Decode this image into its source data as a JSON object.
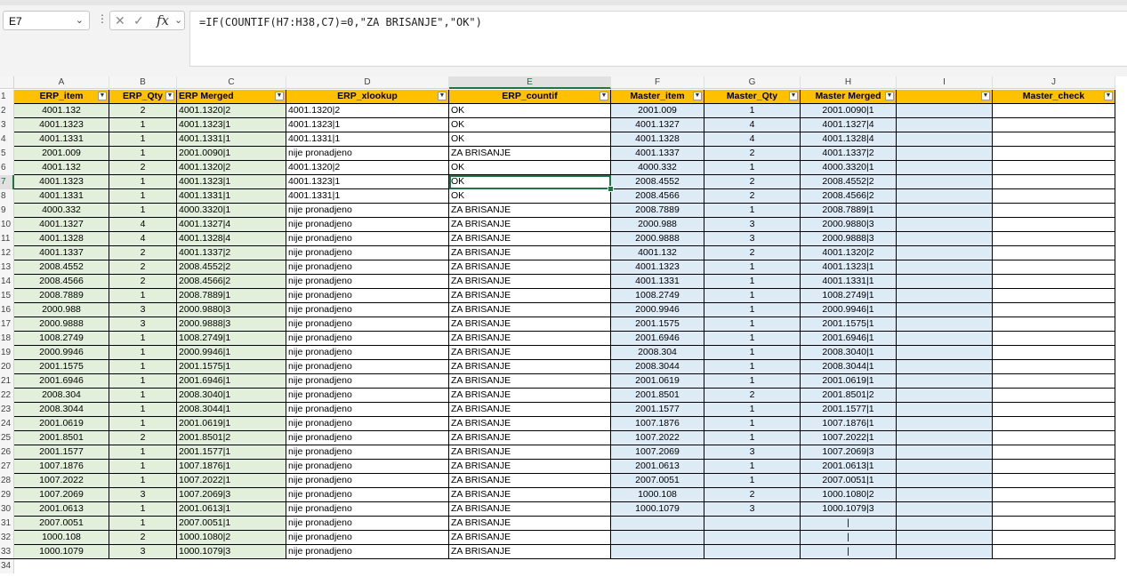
{
  "name_box": {
    "value": "E7",
    "dropdown_icon": "chevron-down-icon"
  },
  "formula_bar": {
    "separator": "⋮",
    "cancel_icon": "close-icon",
    "enter_icon": "check-icon",
    "fx_label": "fx",
    "formula": "=IF(COUNTIF(H7:H38,C7)=0,\"ZA BRISANJE\",\"OK\")"
  },
  "columns": [
    "A",
    "B",
    "C",
    "D",
    "E",
    "F",
    "G",
    "H",
    "I",
    "J"
  ],
  "selected_column": "E",
  "selected_row": 7,
  "headers": [
    "ERP_item",
    "ERP_Qty",
    "ERP Merged",
    "ERP_xlookup",
    "ERP_countif",
    "Master_item",
    "Master_Qty",
    "Master Merged",
    "",
    "Master_check"
  ],
  "rows": [
    [
      "4001.132",
      "2",
      "4001.1320|2",
      "4001.1320|2",
      "OK",
      "2001.009",
      "1",
      "2001.0090|1",
      "",
      ""
    ],
    [
      "4001.1323",
      "1",
      "4001.1323|1",
      "4001.1323|1",
      "OK",
      "4001.1327",
      "4",
      "4001.1327|4",
      "",
      ""
    ],
    [
      "4001.1331",
      "1",
      "4001.1331|1",
      "4001.1331|1",
      "OK",
      "4001.1328",
      "4",
      "4001.1328|4",
      "",
      ""
    ],
    [
      "2001.009",
      "1",
      "2001.0090|1",
      "nije pronadjeno",
      "ZA BRISANJE",
      "4001.1337",
      "2",
      "4001.1337|2",
      "",
      ""
    ],
    [
      "4001.132",
      "2",
      "4001.1320|2",
      "4001.1320|2",
      "OK",
      "4000.332",
      "1",
      "4000.3320|1",
      "",
      ""
    ],
    [
      "4001.1323",
      "1",
      "4001.1323|1",
      "4001.1323|1",
      "OK",
      "2008.4552",
      "2",
      "2008.4552|2",
      "",
      ""
    ],
    [
      "4001.1331",
      "1",
      "4001.1331|1",
      "4001.1331|1",
      "OK",
      "2008.4566",
      "2",
      "2008.4566|2",
      "",
      ""
    ],
    [
      "4000.332",
      "1",
      "4000.3320|1",
      "nije pronadjeno",
      "ZA BRISANJE",
      "2008.7889",
      "1",
      "2008.7889|1",
      "",
      ""
    ],
    [
      "4001.1327",
      "4",
      "4001.1327|4",
      "nije pronadjeno",
      "ZA BRISANJE",
      "2000.988",
      "3",
      "2000.9880|3",
      "",
      ""
    ],
    [
      "4001.1328",
      "4",
      "4001.1328|4",
      "nije pronadjeno",
      "ZA BRISANJE",
      "2000.9888",
      "3",
      "2000.9888|3",
      "",
      ""
    ],
    [
      "4001.1337",
      "2",
      "4001.1337|2",
      "nije pronadjeno",
      "ZA BRISANJE",
      "4001.132",
      "2",
      "4001.1320|2",
      "",
      ""
    ],
    [
      "2008.4552",
      "2",
      "2008.4552|2",
      "nije pronadjeno",
      "ZA BRISANJE",
      "4001.1323",
      "1",
      "4001.1323|1",
      "",
      ""
    ],
    [
      "2008.4566",
      "2",
      "2008.4566|2",
      "nije pronadjeno",
      "ZA BRISANJE",
      "4001.1331",
      "1",
      "4001.1331|1",
      "",
      ""
    ],
    [
      "2008.7889",
      "1",
      "2008.7889|1",
      "nije pronadjeno",
      "ZA BRISANJE",
      "1008.2749",
      "1",
      "1008.2749|1",
      "",
      ""
    ],
    [
      "2000.988",
      "3",
      "2000.9880|3",
      "nije pronadjeno",
      "ZA BRISANJE",
      "2000.9946",
      "1",
      "2000.9946|1",
      "",
      ""
    ],
    [
      "2000.9888",
      "3",
      "2000.9888|3",
      "nije pronadjeno",
      "ZA BRISANJE",
      "2001.1575",
      "1",
      "2001.1575|1",
      "",
      ""
    ],
    [
      "1008.2749",
      "1",
      "1008.2749|1",
      "nije pronadjeno",
      "ZA BRISANJE",
      "2001.6946",
      "1",
      "2001.6946|1",
      "",
      ""
    ],
    [
      "2000.9946",
      "1",
      "2000.9946|1",
      "nije pronadjeno",
      "ZA BRISANJE",
      "2008.304",
      "1",
      "2008.3040|1",
      "",
      ""
    ],
    [
      "2001.1575",
      "1",
      "2001.1575|1",
      "nije pronadjeno",
      "ZA BRISANJE",
      "2008.3044",
      "1",
      "2008.3044|1",
      "",
      ""
    ],
    [
      "2001.6946",
      "1",
      "2001.6946|1",
      "nije pronadjeno",
      "ZA BRISANJE",
      "2001.0619",
      "1",
      "2001.0619|1",
      "",
      ""
    ],
    [
      "2008.304",
      "1",
      "2008.3040|1",
      "nije pronadjeno",
      "ZA BRISANJE",
      "2001.8501",
      "2",
      "2001.8501|2",
      "",
      ""
    ],
    [
      "2008.3044",
      "1",
      "2008.3044|1",
      "nije pronadjeno",
      "ZA BRISANJE",
      "2001.1577",
      "1",
      "2001.1577|1",
      "",
      ""
    ],
    [
      "2001.0619",
      "1",
      "2001.0619|1",
      "nije pronadjeno",
      "ZA BRISANJE",
      "1007.1876",
      "1",
      "1007.1876|1",
      "",
      ""
    ],
    [
      "2001.8501",
      "2",
      "2001.8501|2",
      "nije pronadjeno",
      "ZA BRISANJE",
      "1007.2022",
      "1",
      "1007.2022|1",
      "",
      ""
    ],
    [
      "2001.1577",
      "1",
      "2001.1577|1",
      "nije pronadjeno",
      "ZA BRISANJE",
      "1007.2069",
      "3",
      "1007.2069|3",
      "",
      ""
    ],
    [
      "1007.1876",
      "1",
      "1007.1876|1",
      "nije pronadjeno",
      "ZA BRISANJE",
      "2001.0613",
      "1",
      "2001.0613|1",
      "",
      ""
    ],
    [
      "1007.2022",
      "1",
      "1007.2022|1",
      "nije pronadjeno",
      "ZA BRISANJE",
      "2007.0051",
      "1",
      "2007.0051|1",
      "",
      ""
    ],
    [
      "1007.2069",
      "3",
      "1007.2069|3",
      "nije pronadjeno",
      "ZA BRISANJE",
      "1000.108",
      "2",
      "1000.1080|2",
      "",
      ""
    ],
    [
      "2001.0613",
      "1",
      "2001.0613|1",
      "nije pronadjeno",
      "ZA BRISANJE",
      "1000.1079",
      "3",
      "1000.1079|3",
      "",
      ""
    ],
    [
      "2007.0051",
      "1",
      "2007.0051|1",
      "nije pronadjeno",
      "ZA BRISANJE",
      "",
      "",
      "|",
      "",
      ""
    ],
    [
      "1000.108",
      "2",
      "1000.1080|2",
      "nije pronadjeno",
      "ZA BRISANJE",
      "",
      "",
      "|",
      "",
      ""
    ],
    [
      "1000.1079",
      "3",
      "1000.1079|3",
      "nije pronadjeno",
      "ZA BRISANJE",
      "",
      "",
      "|",
      "",
      ""
    ]
  ],
  "last_row_label": "34",
  "colors": {
    "header_fill": "#ffc000",
    "erp_fill": "#e2efda",
    "master_fill": "#ddebf7",
    "selection": "#217346"
  }
}
